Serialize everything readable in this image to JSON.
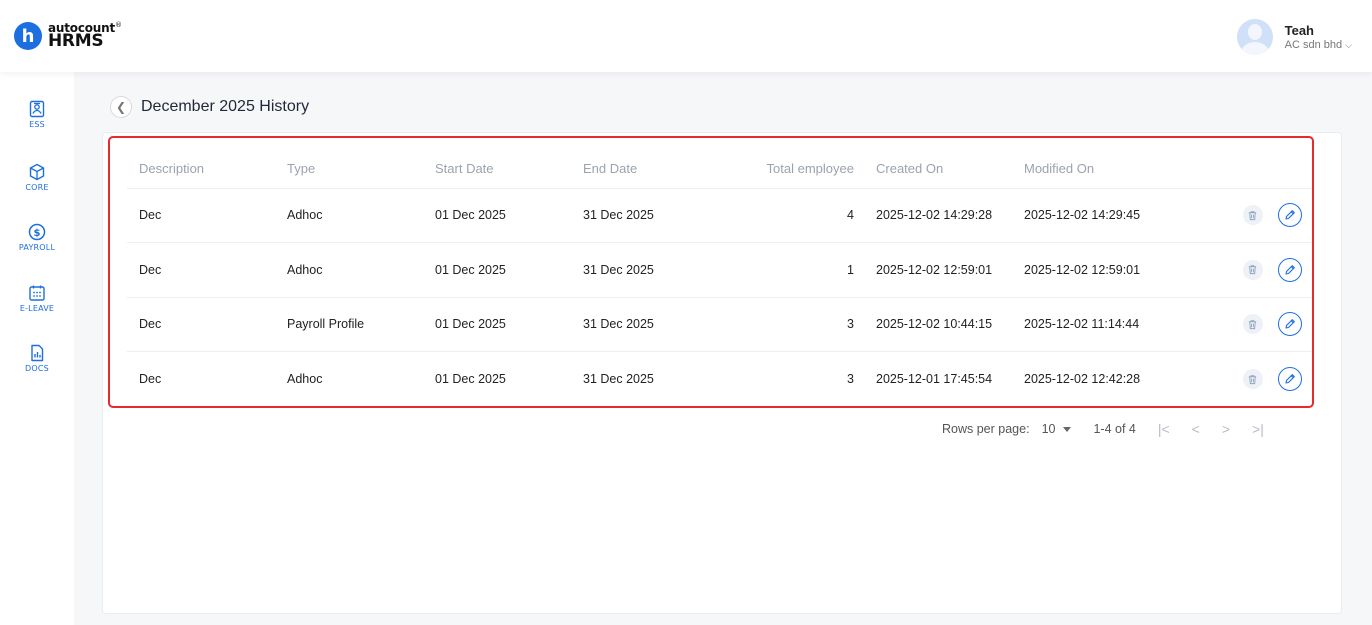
{
  "app": {
    "brand_small": "autocount",
    "brand_big": "HRMS",
    "brand_letter": "h"
  },
  "user": {
    "name": "Teah",
    "company": "AC sdn bhd"
  },
  "sidebar": {
    "items": [
      {
        "label": "ESS",
        "icon": "ess-icon"
      },
      {
        "label": "CORE",
        "icon": "core-icon"
      },
      {
        "label": "PAYROLL",
        "icon": "payroll-icon"
      },
      {
        "label": "E-LEAVE",
        "icon": "calendar-icon"
      },
      {
        "label": "DOCS",
        "icon": "docs-icon"
      }
    ]
  },
  "page": {
    "title": "December 2025 History"
  },
  "table": {
    "columns": [
      "Description",
      "Type",
      "Start Date",
      "End Date",
      "Total employee",
      "Created On",
      "Modified On"
    ],
    "rows": [
      {
        "description": "Dec",
        "type": "Adhoc",
        "start": "01 Dec 2025",
        "end": "31 Dec 2025",
        "total": "4",
        "created": "2025-12-02 14:29:28",
        "modified": "2025-12-02 14:29:45"
      },
      {
        "description": "Dec",
        "type": "Adhoc",
        "start": "01 Dec 2025",
        "end": "31 Dec 2025",
        "total": "1",
        "created": "2025-12-02 12:59:01",
        "modified": "2025-12-02 12:59:01"
      },
      {
        "description": "Dec",
        "type": "Payroll Profile",
        "start": "01 Dec 2025",
        "end": "31 Dec 2025",
        "total": "3",
        "created": "2025-12-02 10:44:15",
        "modified": "2025-12-02 11:14:44"
      },
      {
        "description": "Dec",
        "type": "Adhoc",
        "start": "01 Dec 2025",
        "end": "31 Dec 2025",
        "total": "3",
        "created": "2025-12-01 17:45:54",
        "modified": "2025-12-02 12:42:28"
      }
    ]
  },
  "pagination": {
    "rows_per_page_label": "Rows per page:",
    "rows_per_page": "10",
    "range": "1-4 of 4"
  },
  "colors": {
    "accent": "#1d6fe0",
    "highlight": "#e52b2b"
  }
}
